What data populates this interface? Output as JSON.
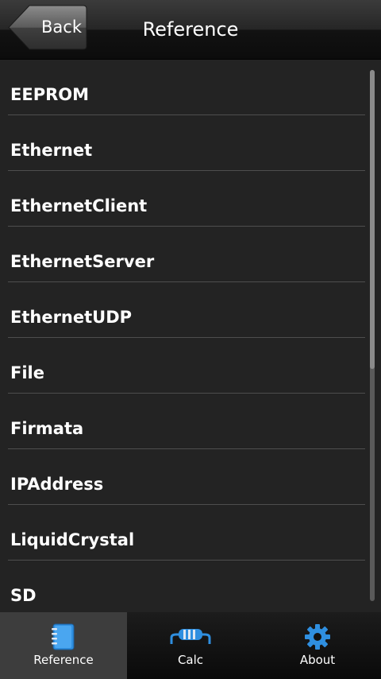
{
  "header": {
    "back_label": "Back",
    "title": "Reference"
  },
  "list": {
    "items": [
      {
        "label": "EEPROM"
      },
      {
        "label": "Ethernet"
      },
      {
        "label": "EthernetClient"
      },
      {
        "label": "EthernetServer"
      },
      {
        "label": "EthernetUDP"
      },
      {
        "label": "File"
      },
      {
        "label": "Firmata"
      },
      {
        "label": "IPAddress"
      },
      {
        "label": "LiquidCrystal"
      },
      {
        "label": "SD"
      }
    ]
  },
  "tabs": [
    {
      "label": "Reference",
      "icon": "notebook-icon",
      "active": true
    },
    {
      "label": "Calc",
      "icon": "resistor-icon",
      "active": false
    },
    {
      "label": "About",
      "icon": "gear-icon",
      "active": false
    }
  ],
  "colors": {
    "accent": "#2f8fe0",
    "background": "#232323",
    "separator": "#4e4e4e"
  }
}
